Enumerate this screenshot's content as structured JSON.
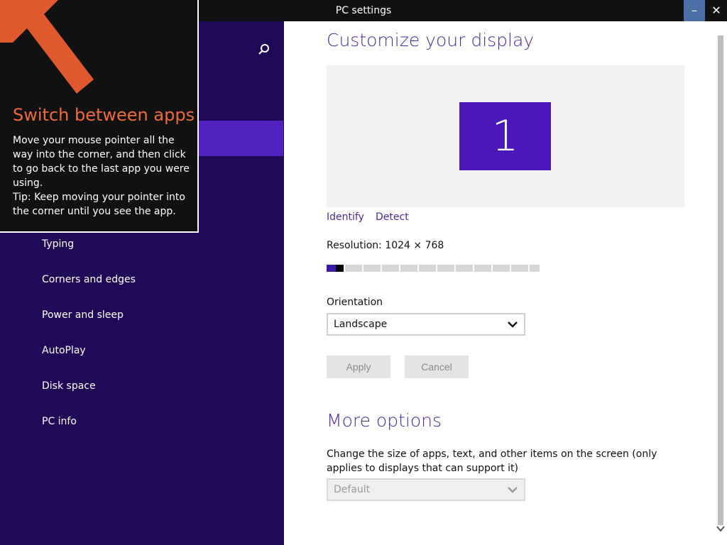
{
  "window": {
    "title": "PC settings",
    "minimize_label": "–",
    "close_label": "✕"
  },
  "nav": {
    "items": [
      {
        "label": "Typing"
      },
      {
        "label": "Corners and edges"
      },
      {
        "label": "Power and sleep"
      },
      {
        "label": "AutoPlay"
      },
      {
        "label": "Disk space"
      },
      {
        "label": "PC info"
      }
    ]
  },
  "tip": {
    "title": "Switch between apps",
    "body_line1": "Move your mouse pointer all the way into the corner, and then click to go back to the last app you were using.",
    "body_line2": "Tip: Keep moving your pointer into the corner until you see the app."
  },
  "display": {
    "heading": "Customize your display",
    "monitor_number": "1",
    "identify_link": "Identify",
    "detect_link": "Detect",
    "resolution_text": "Resolution: 1024 × 768",
    "resolution_slider_level": 0.08,
    "orientation_label": "Orientation",
    "orientation_value": "Landscape",
    "apply_label": "Apply",
    "cancel_label": "Cancel"
  },
  "more_options": {
    "heading": "More options",
    "description": "Change the size of apps, text, and other items on the screen (only applies to displays that can support it)",
    "size_value": "Default"
  },
  "colors": {
    "nav_bg": "#1f0a57",
    "accent": "#5122c0",
    "heading": "#4a2a9e",
    "tip_title": "#ef6a3a"
  }
}
